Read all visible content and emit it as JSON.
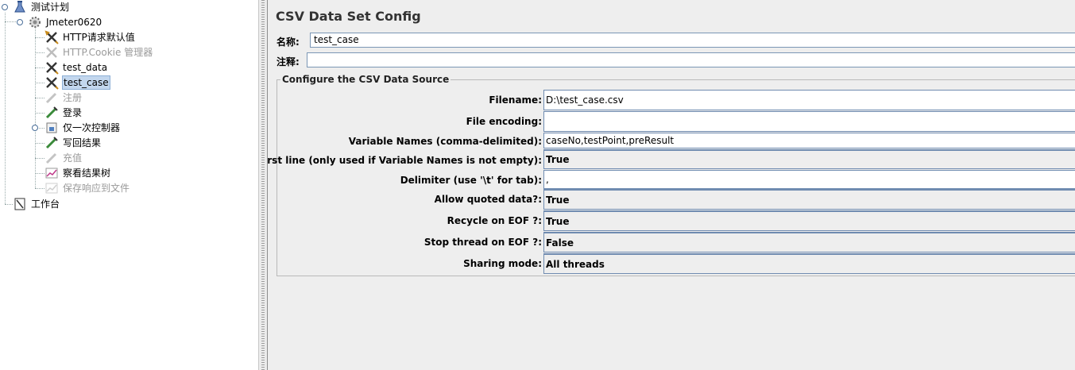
{
  "tree": {
    "root": {
      "label": "测试计划"
    },
    "thread_group": {
      "label": "Jmeter0620"
    },
    "items": [
      {
        "label": "HTTP请求默认值",
        "enabled": true
      },
      {
        "label": "HTTP.Cookie 管理器",
        "enabled": false
      },
      {
        "label": "test_data",
        "enabled": true
      },
      {
        "label": "test_case",
        "enabled": true,
        "selected": true
      },
      {
        "label": "注册",
        "enabled": false
      },
      {
        "label": "登录",
        "enabled": true
      },
      {
        "label": "仅一次控制器",
        "enabled": true
      },
      {
        "label": "写回结果",
        "enabled": true
      },
      {
        "label": "充值",
        "enabled": false
      },
      {
        "label": "察看结果树",
        "enabled": true
      },
      {
        "label": "保存响应到文件",
        "enabled": false
      }
    ],
    "workbench": {
      "label": "工作台"
    }
  },
  "panel": {
    "title": "CSV Data Set Config",
    "name_label": "名称:",
    "name_value": "test_case",
    "comment_label": "注释:",
    "comment_value": "",
    "section_title": "Configure the CSV Data Source",
    "properties": [
      {
        "label": "Filename:",
        "value": "D:\\test_case.csv",
        "kind": "text"
      },
      {
        "label": "File encoding:",
        "value": "",
        "kind": "text"
      },
      {
        "label": "Variable Names (comma-delimited):",
        "value": "caseNo,testPoint,preResult",
        "kind": "text"
      },
      {
        "label": "Ignore first line (only used if Variable Names is not empty):",
        "value": "True",
        "kind": "combo"
      },
      {
        "label": "Delimiter (use '\\t' for tab):",
        "value": ",",
        "kind": "text"
      },
      {
        "label": "Allow quoted data?:",
        "value": "True",
        "kind": "combo"
      },
      {
        "label": "Recycle on EOF ?:",
        "value": "True",
        "kind": "combo"
      },
      {
        "label": "Stop thread on EOF ?:",
        "value": "False",
        "kind": "combo"
      },
      {
        "label": "Sharing mode:",
        "value": "All threads",
        "kind": "combo"
      }
    ]
  },
  "icons": {
    "root": "test-plan-flask-icon",
    "thread_group": "thread-group-gear-icon",
    "config": "config-wrench-icon",
    "sampler": "sampler-pipette-icon",
    "controller": "controller-icon",
    "listener": "listener-graph-icon",
    "workbench": "workbench-icon"
  },
  "colors": {
    "selection_bg": "#c3d7ee",
    "disabled_text": "#9a9a9a",
    "panel_bg": "#eeeeee",
    "field_border": "#6f8bb0"
  }
}
